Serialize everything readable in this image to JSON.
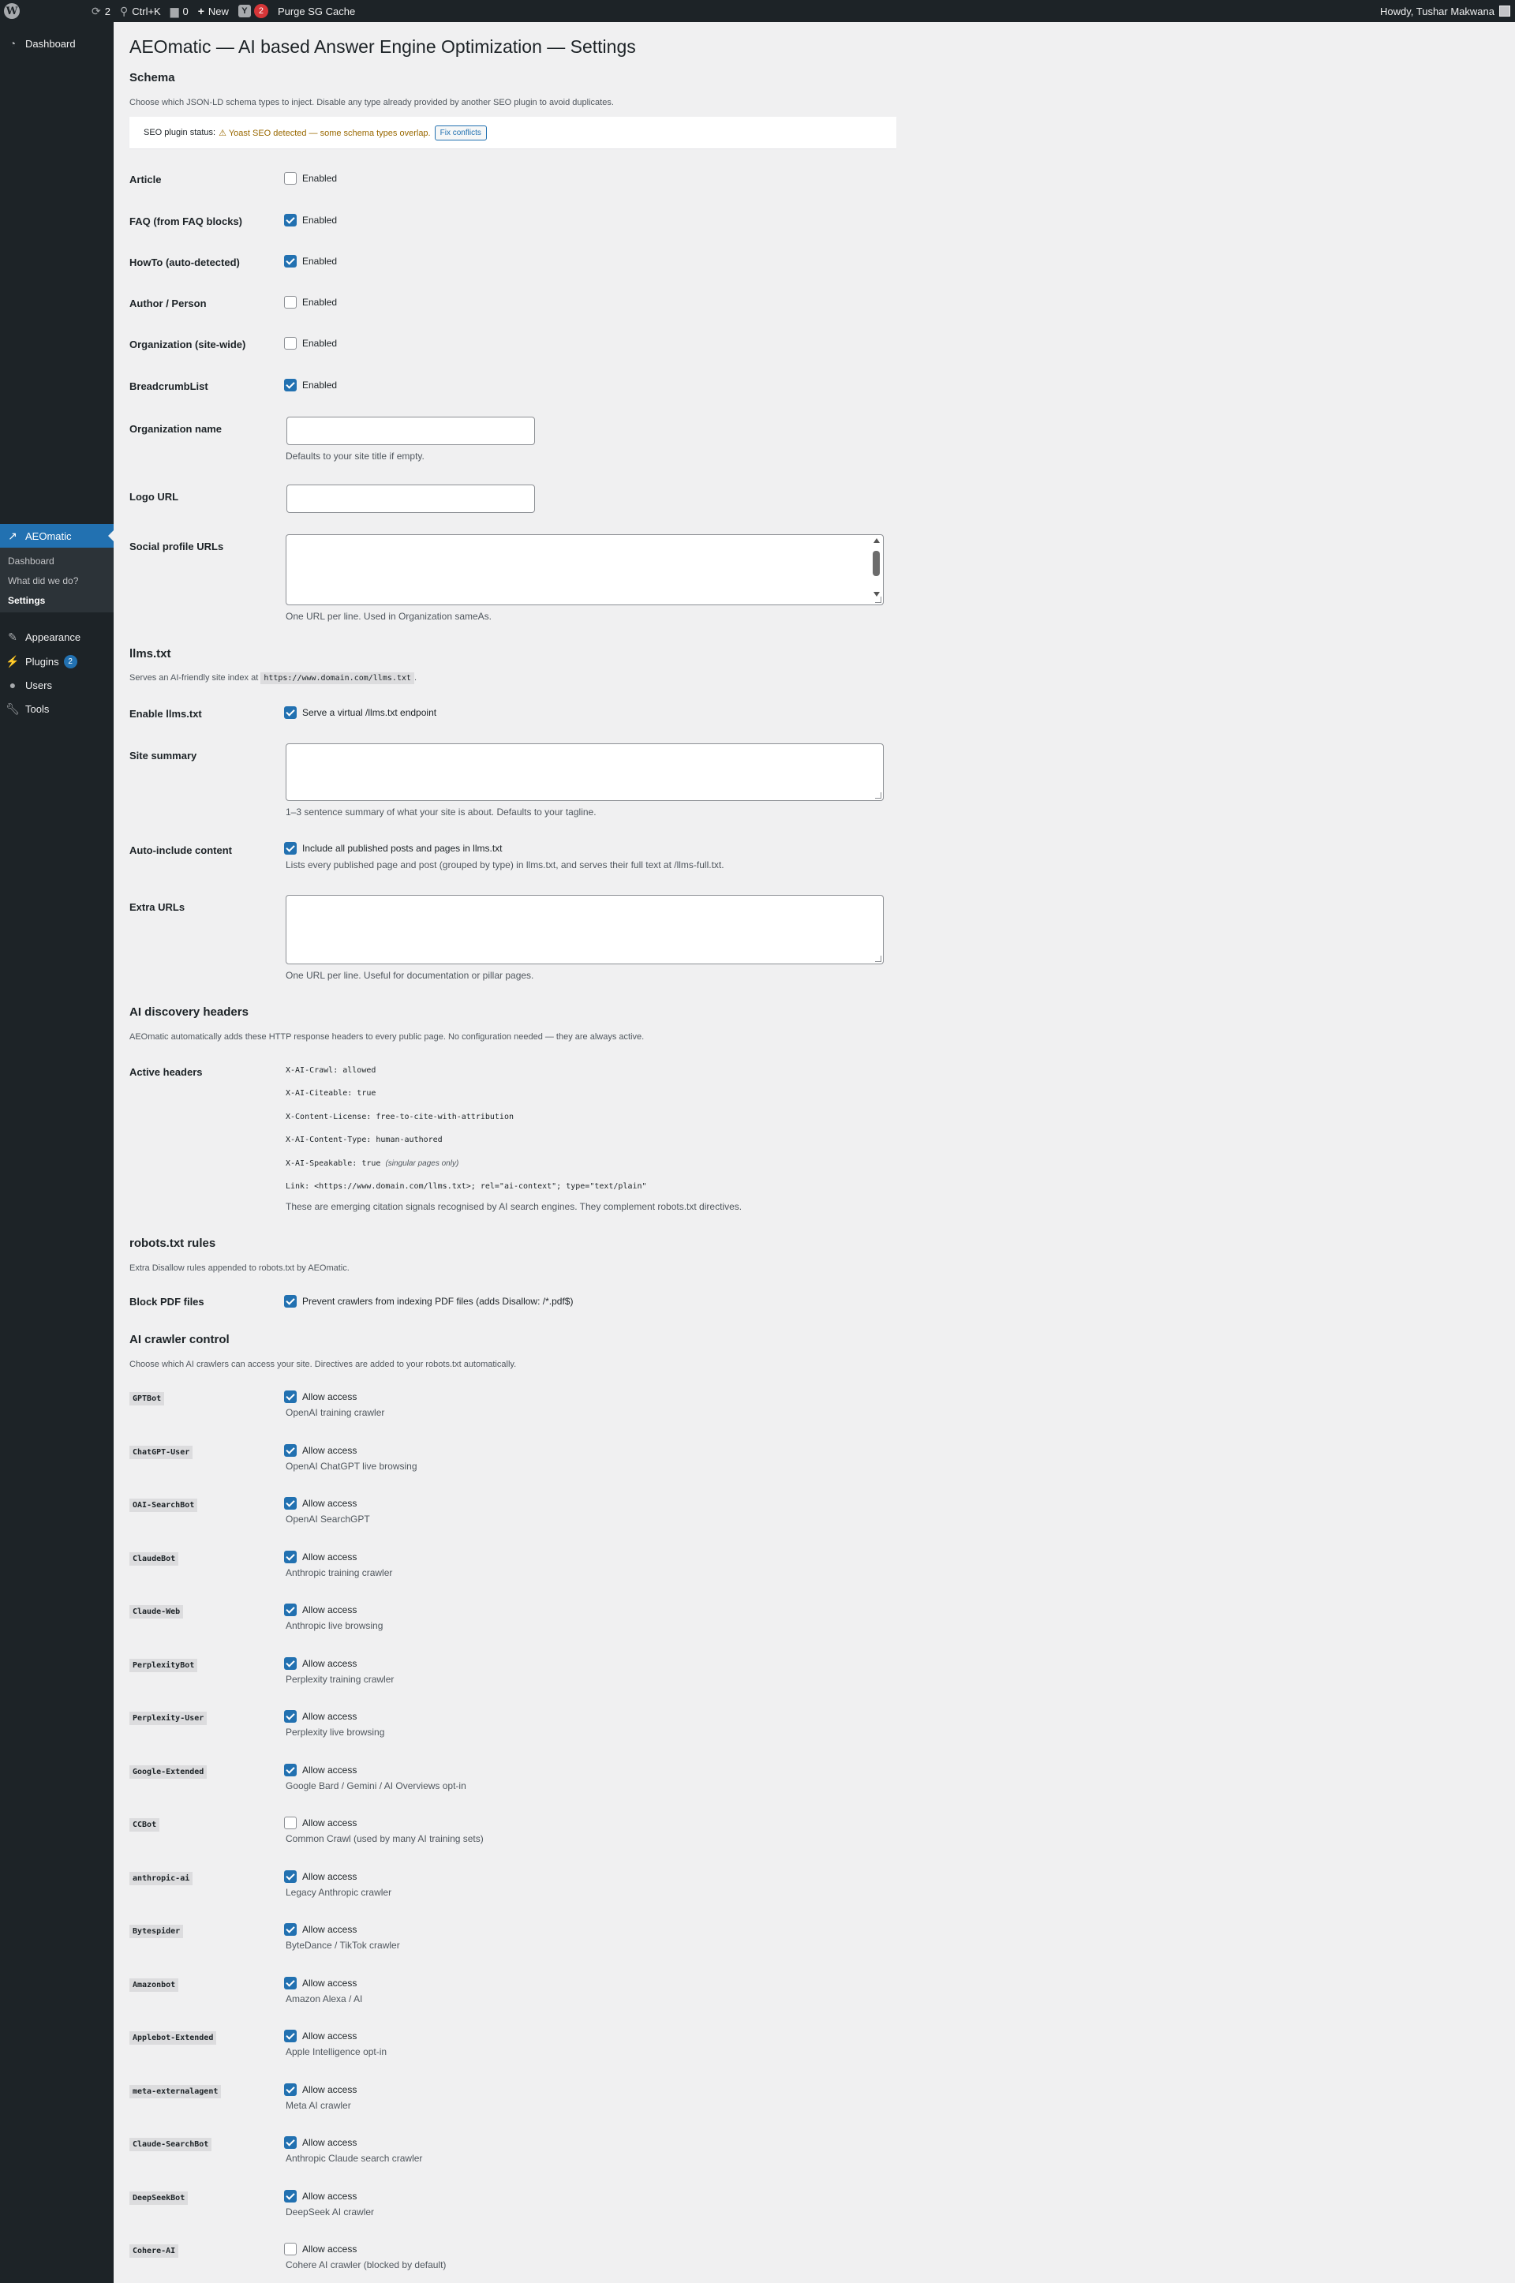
{
  "admin_bar": {
    "updates_count": "2",
    "search_shortcut": "Ctrl+K",
    "comments_count": "0",
    "new_label": "New",
    "yoast_badge": "2",
    "purge_label": "Purge SG Cache",
    "howdy": "Howdy, Tushar Makwana"
  },
  "sidebar": {
    "dashboard": "Dashboard",
    "aeomatic": "AEOmatic",
    "sub_items": [
      "Dashboard",
      "What did we do?",
      "Settings"
    ],
    "appearance": "Appearance",
    "plugins": "Plugins",
    "plugins_count": "2",
    "users": "Users",
    "tools": "Tools"
  },
  "page": {
    "title": "AEOmatic — AI based Answer Engine Optimization — Settings"
  },
  "schema": {
    "title": "Schema",
    "desc": "Choose which JSON-LD schema types to inject. Disable any type already provided by another SEO plugin to avoid duplicates.",
    "notice_label": "SEO plugin status:",
    "notice_warn": "⚠ Yoast SEO detected — some schema types overlap.",
    "fix_button": "Fix conflicts",
    "enabled_label": "Enabled",
    "rows": [
      {
        "label": "Article",
        "checked": false
      },
      {
        "label": "FAQ (from FAQ blocks)",
        "checked": true
      },
      {
        "label": "HowTo (auto-detected)",
        "checked": true
      },
      {
        "label": "Author / Person",
        "checked": false
      },
      {
        "label": "Organization (site-wide)",
        "checked": false
      },
      {
        "label": "BreadcrumbList",
        "checked": true
      }
    ],
    "org_name_label": "Organization name",
    "org_name_help": "Defaults to your site title if empty.",
    "logo_label": "Logo URL",
    "social_label": "Social profile URLs",
    "social_help": "One URL per line. Used in Organization sameAs."
  },
  "llms": {
    "title": "llms.txt",
    "desc_prefix": "Serves an AI-friendly site index at",
    "desc_code": "https://www.domain.com/llms.txt",
    "desc_suffix": ".",
    "enable_label": "Enable llms.txt",
    "enable_cb": "Serve a virtual /llms.txt endpoint",
    "summary_label": "Site summary",
    "summary_help": "1–3 sentence summary of what your site is about. Defaults to your tagline.",
    "auto_label": "Auto-include content",
    "auto_cb": "Include all published posts and pages in llms.txt",
    "auto_help": "Lists every published page and post (grouped by type) in llms.txt, and serves their full text at /llms-full.txt.",
    "extra_label": "Extra URLs",
    "extra_help": "One URL per line. Useful for documentation or pillar pages."
  },
  "headers": {
    "title": "AI discovery headers",
    "desc": "AEOmatic automatically adds these HTTP response headers to every public page. No configuration needed — they are always active.",
    "label": "Active headers",
    "lines": [
      "X-AI-Crawl: allowed",
      "X-AI-Citeable: true",
      "X-Content-License: free-to-cite-with-attribution",
      "X-AI-Content-Type: human-authored",
      "X-AI-Speakable: true",
      "Link: <https://www.domain.com/llms.txt>; rel=\"ai-context\"; type=\"text/plain\""
    ],
    "speakable_note": "(singular pages only)",
    "help": "These are emerging citation signals recognised by AI search engines. They complement robots.txt directives."
  },
  "robots": {
    "title": "robots.txt rules",
    "desc": "Extra Disallow rules appended to robots.txt by AEOmatic.",
    "pdf_label": "Block PDF files",
    "pdf_cb": "Prevent crawlers from indexing PDF files (adds Disallow: /*.pdf$)"
  },
  "crawlers": {
    "title": "AI crawler control",
    "desc": "Choose which AI crawlers can access your site. Directives are added to your robots.txt automatically.",
    "allow_label": "Allow access",
    "bots": [
      {
        "name": "GPTBot",
        "desc": "OpenAI training crawler",
        "checked": true
      },
      {
        "name": "ChatGPT-User",
        "desc": "OpenAI ChatGPT live browsing",
        "checked": true
      },
      {
        "name": "OAI-SearchBot",
        "desc": "OpenAI SearchGPT",
        "checked": true
      },
      {
        "name": "ClaudeBot",
        "desc": "Anthropic training crawler",
        "checked": true
      },
      {
        "name": "Claude-Web",
        "desc": "Anthropic live browsing",
        "checked": true
      },
      {
        "name": "PerplexityBot",
        "desc": "Perplexity training crawler",
        "checked": true
      },
      {
        "name": "Perplexity-User",
        "desc": "Perplexity live browsing",
        "checked": true
      },
      {
        "name": "Google-Extended",
        "desc": "Google Bard / Gemini / AI Overviews opt-in",
        "checked": true
      },
      {
        "name": "CCBot",
        "desc": "Common Crawl (used by many AI training sets)",
        "checked": false
      },
      {
        "name": "anthropic-ai",
        "desc": "Legacy Anthropic crawler",
        "checked": true
      },
      {
        "name": "Bytespider",
        "desc": "ByteDance / TikTok crawler",
        "checked": true
      },
      {
        "name": "Amazonbot",
        "desc": "Amazon Alexa / AI",
        "checked": true
      },
      {
        "name": "Applebot-Extended",
        "desc": "Apple Intelligence opt-in",
        "checked": true
      },
      {
        "name": "meta-externalagent",
        "desc": "Meta AI crawler",
        "checked": true
      },
      {
        "name": "Claude-SearchBot",
        "desc": "Anthropic Claude search crawler",
        "checked": true
      },
      {
        "name": "DeepSeekBot",
        "desc": "DeepSeek AI crawler",
        "checked": true
      },
      {
        "name": "Cohere-AI",
        "desc": "Cohere AI crawler (blocked by default)",
        "checked": false
      }
    ]
  }
}
